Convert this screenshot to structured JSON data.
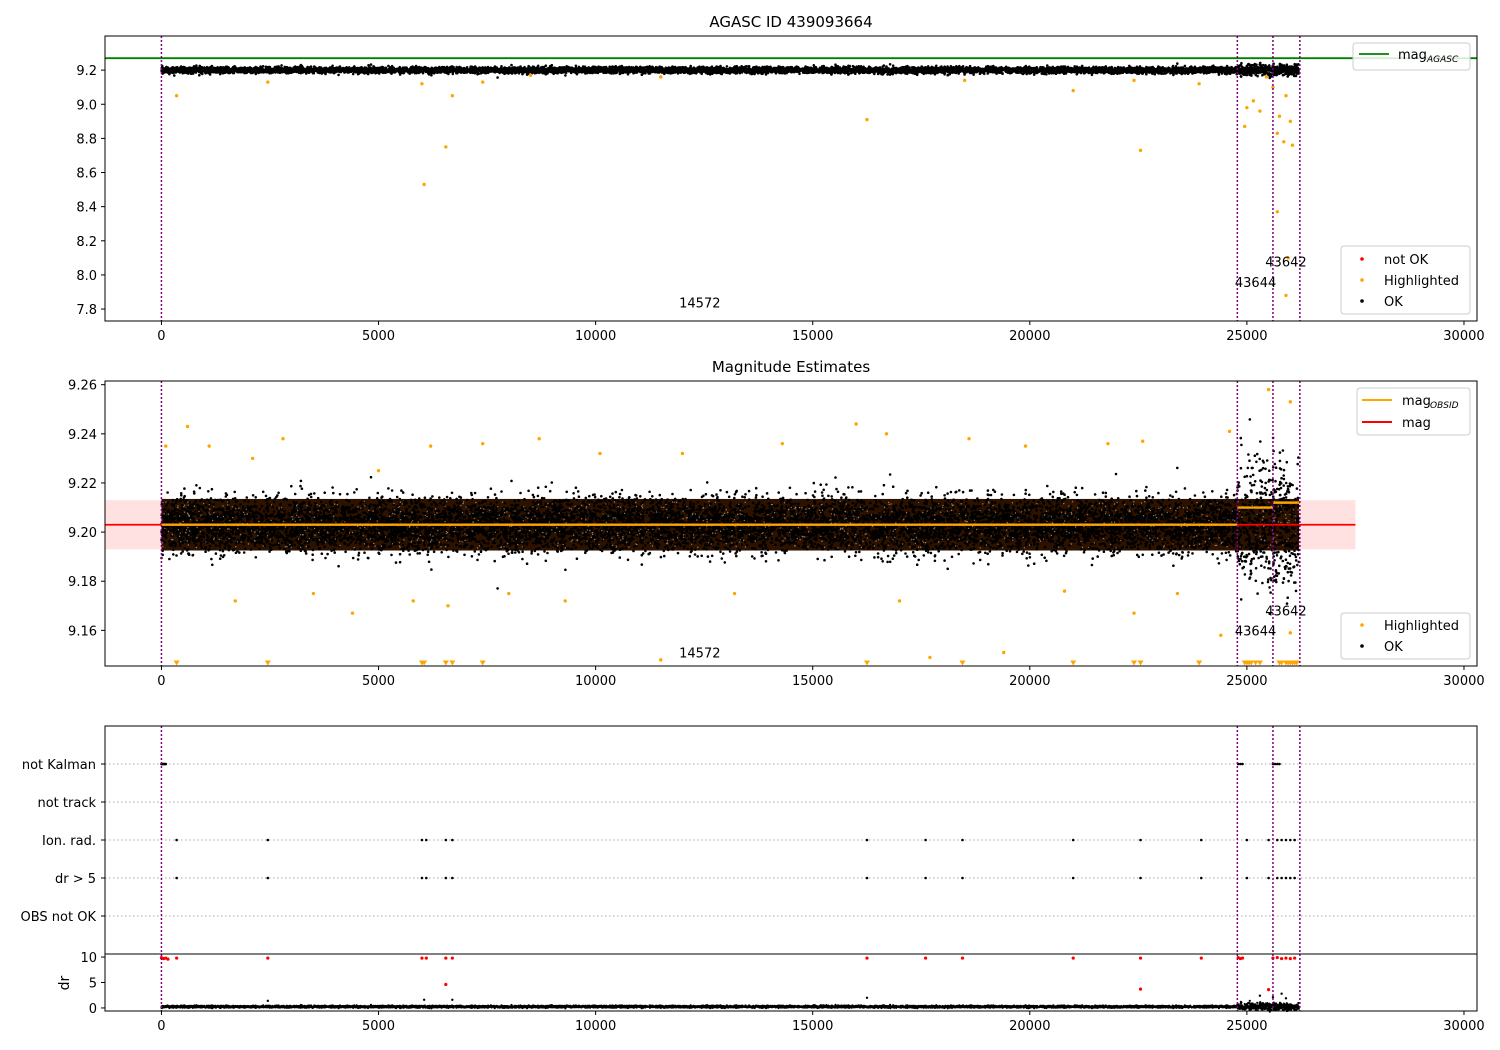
{
  "chart_data": [
    {
      "type": "scatter",
      "title": "AGASC ID 439093664",
      "xlabel": "",
      "ylabel": "",
      "xlim": [
        -1300,
        30300
      ],
      "ylim": [
        7.73,
        9.4
      ],
      "x_ticks": [
        0,
        5000,
        10000,
        15000,
        20000,
        25000,
        30000
      ],
      "y_ticks": [
        7.8,
        8.0,
        8.2,
        8.4,
        8.6,
        8.8,
        9.0,
        9.2
      ],
      "y_tick_labels": [
        "7.8",
        "8.0",
        "8.2",
        "8.4",
        "8.6",
        "8.8",
        "9.0",
        "9.2"
      ],
      "vlines": [
        0,
        24780,
        25600,
        26220
      ],
      "hlines": [
        {
          "y": 9.27,
          "color": "#008000",
          "series": "mag_agasc"
        }
      ],
      "ok_band": {
        "x_start": 0,
        "x_end": 26200,
        "y_center": 9.2,
        "y_spread": 0.02
      },
      "annotations": [
        {
          "text": "14572",
          "x": 12400,
          "y": 7.81
        },
        {
          "text": "43644",
          "x": 25200,
          "y": 7.93
        },
        {
          "text": "43642",
          "x": 25900,
          "y": 8.05
        }
      ],
      "legend_lines": [
        {
          "name": "mag",
          "sub": "AGASC",
          "color": "#008000"
        }
      ],
      "legend_points": [
        {
          "name": "not OK",
          "color": "#ff0000"
        },
        {
          "name": "Highlighted",
          "color": "#ffa500"
        },
        {
          "name": "OK",
          "color": "#000000"
        }
      ],
      "highlighted_points": [
        [
          350,
          9.05
        ],
        [
          2450,
          9.13
        ],
        [
          6000,
          9.12
        ],
        [
          6050,
          8.53
        ],
        [
          6550,
          8.75
        ],
        [
          6700,
          9.05
        ],
        [
          7400,
          9.13
        ],
        [
          8500,
          9.17
        ],
        [
          11500,
          9.16
        ],
        [
          16250,
          8.91
        ],
        [
          18500,
          9.14
        ],
        [
          21000,
          9.08
        ],
        [
          22550,
          8.73
        ],
        [
          22400,
          9.14
        ],
        [
          23900,
          9.12
        ],
        [
          24950,
          8.87
        ],
        [
          25000,
          8.98
        ],
        [
          25150,
          9.02
        ],
        [
          25300,
          8.96
        ],
        [
          25700,
          8.37
        ],
        [
          25700,
          8.83
        ],
        [
          25750,
          8.93
        ],
        [
          25850,
          8.78
        ],
        [
          25900,
          7.88
        ],
        [
          25950,
          8.1
        ],
        [
          26000,
          8.9
        ],
        [
          26050,
          8.76
        ],
        [
          25450,
          9.16
        ],
        [
          25600,
          9.1
        ],
        [
          25900,
          9.05
        ]
      ],
      "notok_points": []
    },
    {
      "type": "scatter",
      "title": "Magnitude Estimates",
      "xlabel": "",
      "ylabel": "",
      "xlim": [
        -1300,
        30300
      ],
      "ylim": [
        9.1455,
        9.2615
      ],
      "x_ticks": [
        0,
        5000,
        10000,
        15000,
        20000,
        25000,
        30000
      ],
      "y_ticks": [
        9.16,
        9.18,
        9.2,
        9.22,
        9.24,
        9.26
      ],
      "y_tick_labels": [
        "9.16",
        "9.18",
        "9.20",
        "9.22",
        "9.24",
        "9.26"
      ],
      "vlines": [
        0,
        24780,
        25600,
        26220
      ],
      "red_band": {
        "x_start": -1300,
        "x_end": 27500,
        "y_low": 9.193,
        "y_high": 9.213
      },
      "red_line": {
        "x_start": -1300,
        "x_end": 27500,
        "y": 9.203
      },
      "orange_segments": [
        {
          "x_start": 0,
          "x_end": 24780,
          "y": 9.203
        },
        {
          "x_start": 24780,
          "x_end": 25600,
          "y": 9.21
        },
        {
          "x_start": 25600,
          "x_end": 26220,
          "y": 9.212
        }
      ],
      "ok_band": {
        "x_start": 0,
        "x_end": 26200,
        "y_center": 9.203,
        "y_spread": 0.012
      },
      "annotations": [
        {
          "text": "14572",
          "x": 12400,
          "y": 9.149
        },
        {
          "text": "43644",
          "x": 25200,
          "y": 9.158
        },
        {
          "text": "43642",
          "x": 25900,
          "y": 9.166
        }
      ],
      "legend_lines": [
        {
          "name": "mag",
          "sub": "OBSID",
          "color": "#ffa500"
        },
        {
          "name": "mag",
          "sub": "",
          "color": "#ff0000"
        }
      ],
      "legend_points": [
        {
          "name": "Highlighted",
          "color": "#ffa500"
        },
        {
          "name": "OK",
          "color": "#000000"
        }
      ],
      "highlighted_points": [
        [
          100,
          9.235
        ],
        [
          600,
          9.243
        ],
        [
          1100,
          9.235
        ],
        [
          1700,
          9.172
        ],
        [
          2100,
          9.23
        ],
        [
          2800,
          9.238
        ],
        [
          3500,
          9.175
        ],
        [
          4400,
          9.167
        ],
        [
          5000,
          9.225
        ],
        [
          5800,
          9.172
        ],
        [
          6200,
          9.235
        ],
        [
          6600,
          9.17
        ],
        [
          7400,
          9.236
        ],
        [
          8000,
          9.175
        ],
        [
          8700,
          9.238
        ],
        [
          9300,
          9.172
        ],
        [
          10100,
          9.232
        ],
        [
          11500,
          9.148
        ],
        [
          12000,
          9.232
        ],
        [
          13200,
          9.175
        ],
        [
          14300,
          9.236
        ],
        [
          16000,
          9.244
        ],
        [
          16700,
          9.24
        ],
        [
          17000,
          9.172
        ],
        [
          17700,
          9.149
        ],
        [
          18600,
          9.238
        ],
        [
          19400,
          9.151
        ],
        [
          19900,
          9.235
        ],
        [
          20800,
          9.176
        ],
        [
          21800,
          9.236
        ],
        [
          22400,
          9.167
        ],
        [
          22600,
          9.237
        ],
        [
          23400,
          9.175
        ],
        [
          24400,
          9.158
        ],
        [
          24600,
          9.241
        ],
        [
          25500,
          9.258
        ],
        [
          26000,
          9.159
        ],
        [
          26000,
          9.253
        ]
      ],
      "floor_points": [
        350,
        2450,
        6000,
        6050,
        6550,
        6700,
        7400,
        16250,
        18450,
        21000,
        22400,
        22550,
        23900,
        24950,
        25000,
        25050,
        25100,
        25200,
        25300,
        25750,
        25800,
        25900,
        25950,
        26000,
        26050,
        26100,
        26150
      ],
      "floor_y": 9.1465
    },
    {
      "type": "scatter",
      "title": "",
      "xlabel": "",
      "ylabel": "",
      "xlim": [
        -1300,
        30300
      ],
      "categories": [
        "not Kalman",
        "not track",
        "Ion. rad.",
        "dr > 5",
        "OBS not OK"
      ],
      "vlines": [
        0,
        24780,
        25600,
        26220
      ],
      "flag_points": {
        "not Kalman": [
          0,
          20,
          40,
          60,
          80,
          100,
          24800,
          24850,
          24900,
          25600,
          25650,
          25700,
          25750
        ],
        "not track": [],
        "Ion. rad.": [
          350,
          2450,
          6000,
          6100,
          6550,
          6700,
          16250,
          17600,
          18450,
          21000,
          22550,
          23950,
          25000,
          25500,
          25700,
          25800,
          25900,
          26000,
          26100
        ],
        "dr > 5": [
          350,
          2450,
          6000,
          6100,
          6550,
          6700,
          16250,
          17600,
          18450,
          21000,
          22550,
          23950,
          25000,
          25500,
          25700,
          25800,
          25900,
          26000,
          26100
        ],
        "OBS not OK": []
      }
    },
    {
      "type": "scatter",
      "title": "",
      "xlabel": "",
      "ylabel": "dr",
      "xlim": [
        -1300,
        30300
      ],
      "ylim": [
        -0.6,
        10.6
      ],
      "x_ticks": [
        0,
        5000,
        10000,
        15000,
        20000,
        25000,
        30000
      ],
      "y_ticks": [
        0,
        5,
        10
      ],
      "y_tick_labels": [
        "0",
        "5",
        "10"
      ],
      "vlines": [
        0,
        24780,
        25600,
        26220
      ],
      "ok_band": {
        "x_start": 0,
        "x_end": 26200,
        "y_center": 0.25,
        "y_spread": 0.22
      },
      "notok_points": [
        [
          0,
          9.9
        ],
        [
          50,
          9.7
        ],
        [
          100,
          9.8
        ],
        [
          150,
          9.6
        ],
        [
          350,
          9.8
        ],
        [
          2450,
          9.8
        ],
        [
          6000,
          9.8
        ],
        [
          6100,
          9.8
        ],
        [
          6550,
          9.8
        ],
        [
          6700,
          9.8
        ],
        [
          16250,
          9.8
        ],
        [
          17600,
          9.8
        ],
        [
          18450,
          9.8
        ],
        [
          21000,
          9.8
        ],
        [
          22550,
          9.8
        ],
        [
          23950,
          9.8
        ],
        [
          24800,
          9.9
        ],
        [
          24850,
          9.7
        ],
        [
          24900,
          9.8
        ],
        [
          25600,
          9.8
        ],
        [
          25700,
          9.9
        ],
        [
          25800,
          9.7
        ],
        [
          25900,
          9.8
        ],
        [
          26000,
          9.7
        ],
        [
          26100,
          9.8
        ],
        [
          25500,
          3.6
        ],
        [
          22550,
          3.7
        ],
        [
          6550,
          4.6
        ]
      ],
      "extra_ok_points": [
        [
          2450,
          1.4
        ],
        [
          6050,
          1.6
        ],
        [
          6700,
          1.6
        ],
        [
          16250,
          2.0
        ],
        [
          25300,
          2.4
        ],
        [
          25600,
          2.1
        ],
        [
          25800,
          2.8
        ],
        [
          25900,
          1.9
        ]
      ]
    }
  ]
}
